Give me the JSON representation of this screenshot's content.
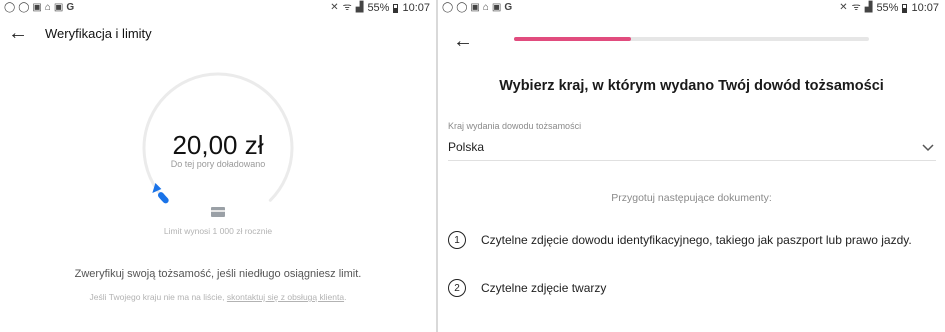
{
  "status_bar": {
    "left_icons": [
      "chat-bubble-icon",
      "chat-bubble-icon",
      "image-icon",
      "home-icon",
      "gallery-icon",
      "google-g-icon"
    ],
    "battery": "55%",
    "time": "10:07"
  },
  "left_screen": {
    "title": "Weryfikacja i limity",
    "amount": "20,00 zł",
    "amount_caption": "Do tej pory doładowano",
    "limit_note": "Limit wynosi 1 000 zł rocznie",
    "gauge_fill_fraction": 0.02,
    "accent_color": "#1a73e8",
    "verify_message": "Zweryfikuj swoją tożsamość, jeśli niedługo osiągniesz limit.",
    "footer_note_prefix": "Jeśli Twojego kraju nie ma na liście, ",
    "footer_note_link": "skontaktuj się z obsługą klienta",
    "footer_note_suffix": "."
  },
  "right_screen": {
    "progress_fraction": 0.33,
    "progress_color": "#e14c7e",
    "heading": "Wybierz kraj, w którym wydano Twój dowód tożsamości",
    "field_label": "Kraj wydania dowodu tożsamości",
    "selected_country": "Polska",
    "prepare_text": "Przygotuj następujące dokumenty:",
    "documents": [
      {
        "number": "1",
        "text": "Czytelne zdjęcie dowodu identyfikacyjnego, takiego jak paszport lub prawo jazdy."
      },
      {
        "number": "2",
        "text": "Czytelne zdjęcie twarzy"
      }
    ]
  }
}
